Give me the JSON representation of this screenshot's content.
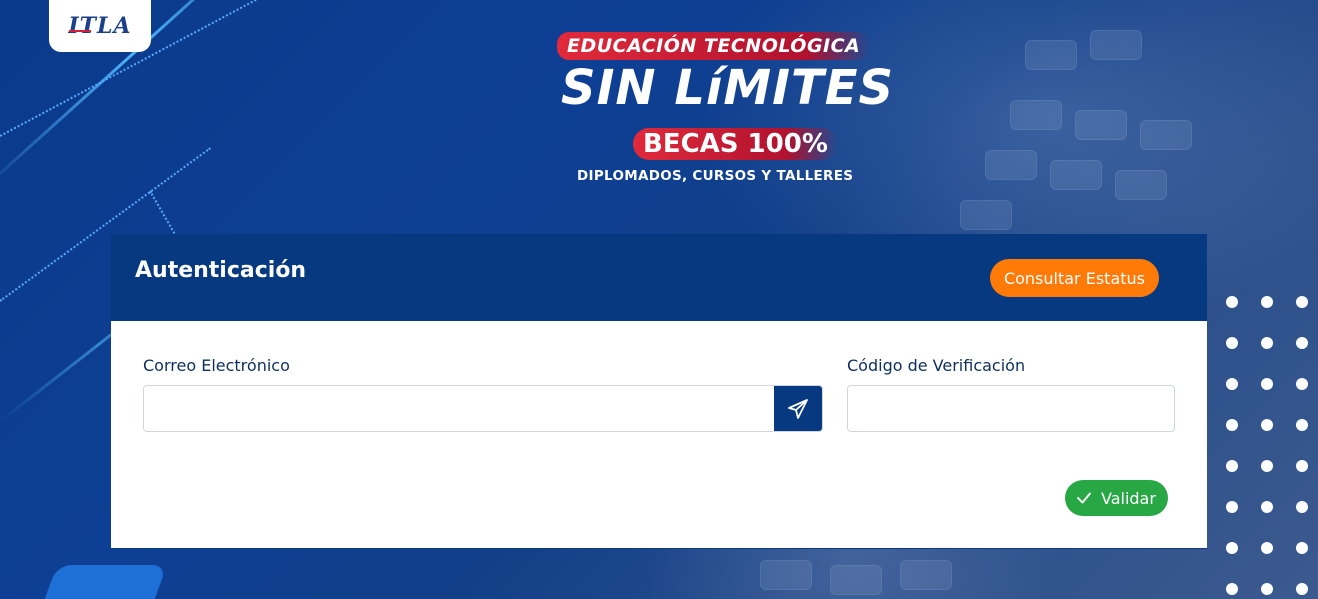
{
  "logo": {
    "text": "ITLA"
  },
  "banner": {
    "tag": "EDUCACIÓN TECNOLÓGICA",
    "headline": "SIN LíMITES",
    "becas": "BECAS 100%",
    "subline": "DIPLOMADOS, CURSOS Y TALLERES"
  },
  "auth": {
    "title": "Autenticación",
    "status_button": "Consultar Estatus",
    "email_label": "Correo Electrónico",
    "email_value": "",
    "email_placeholder": "",
    "code_label": "Código de Verificación",
    "code_value": "",
    "code_placeholder": "",
    "validate_button": "Validar"
  },
  "icons": {
    "send": "send-icon",
    "check": "check-icon"
  },
  "colors": {
    "header_blue": "#06397f",
    "status_orange": "#ff7a06",
    "validate_green": "#28a745",
    "banner_red": "#e12a3b"
  }
}
